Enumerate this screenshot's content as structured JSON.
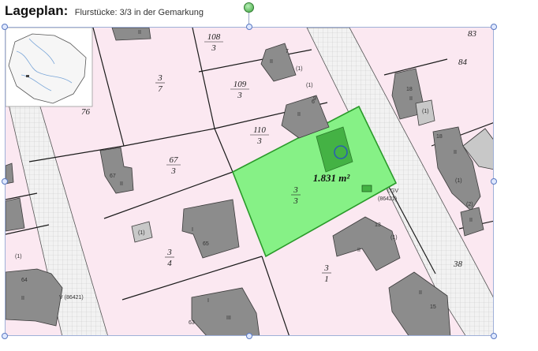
{
  "header": {
    "title": "Lageplan:",
    "subtitle": "Flurstücke: 3/3 in der Gemarkung"
  },
  "map": {
    "selected_parcel_area": "1.831 m²",
    "parcel_labels": [
      {
        "num": "108",
        "den": "3"
      },
      {
        "num": "3",
        "den": "7"
      },
      {
        "num": "109",
        "den": "3"
      },
      {
        "num": "110",
        "den": "3"
      },
      {
        "num": "67",
        "den": "3"
      },
      {
        "num": "3",
        "den": "3"
      },
      {
        "num": "3",
        "den": "4"
      },
      {
        "num": "3",
        "den": "1"
      }
    ],
    "house_numbers": [
      "83",
      "84",
      "76",
      "38"
    ],
    "building_labels": [
      "II",
      "II",
      "7",
      "(1)",
      "6",
      "9",
      "II",
      "(1)",
      "18",
      "II",
      "(1)",
      "18",
      "II",
      "(1)",
      "(2)",
      "II",
      "67",
      "II",
      "I",
      "65",
      "(1)",
      "13",
      "(1)",
      "II",
      "64",
      "63",
      "III",
      "15",
      "II",
      "(1)",
      "II",
      "I"
    ],
    "road_label": "LGV",
    "road_code": "(86421)",
    "road_code_left": "V (86421)"
  },
  "colors": {
    "parcel_fill": "#fbe8f1",
    "selected_fill": "#86f186",
    "building_fill": "#8c8c8c",
    "street_fill": "#ececec",
    "accent_handle": "#5a79c2"
  }
}
